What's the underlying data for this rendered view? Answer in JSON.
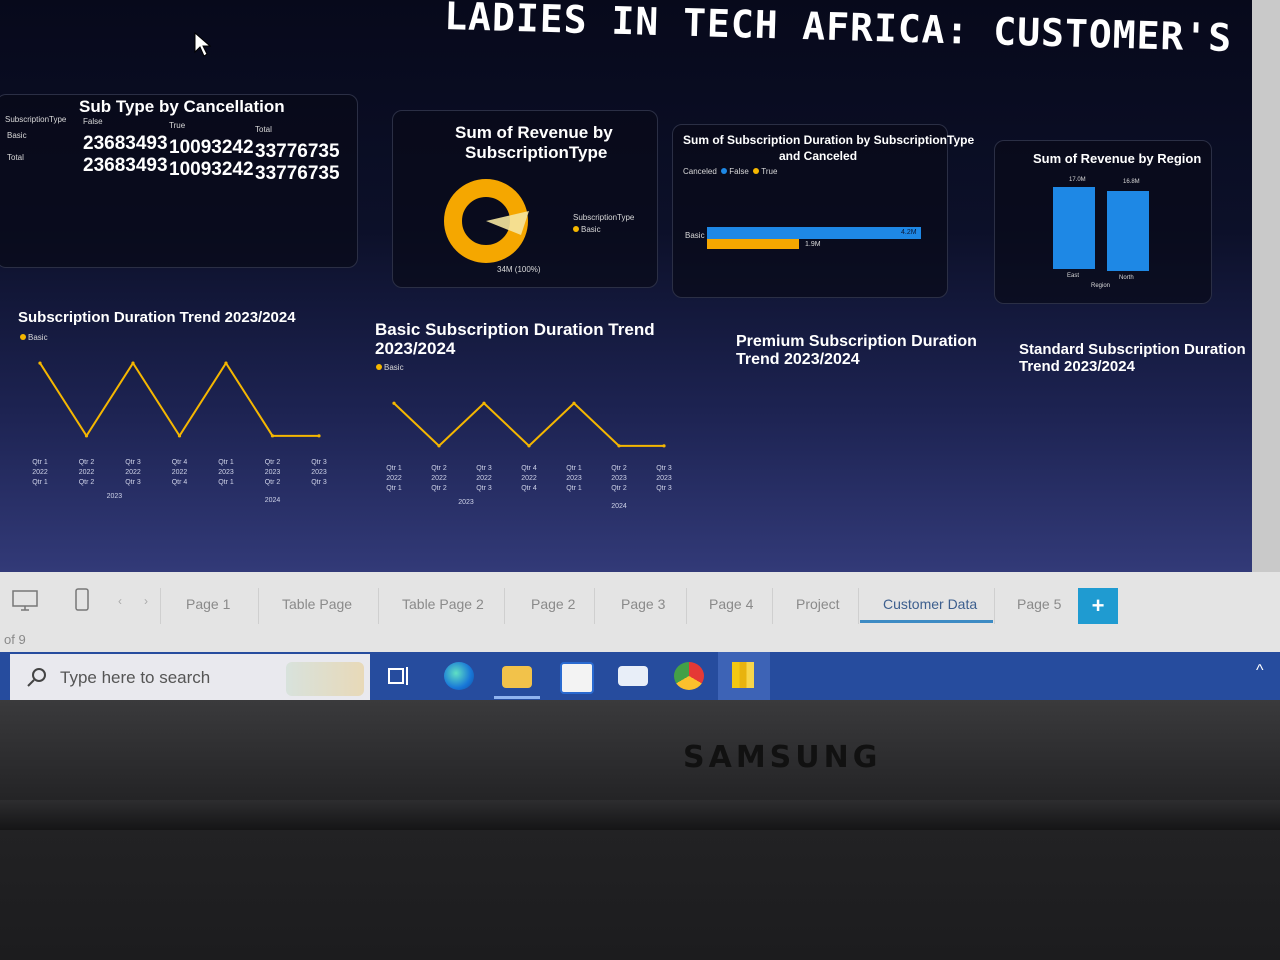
{
  "report": {
    "title": "LADIES IN TECH AFRICA: CUSTOMER'S DATA",
    "matrix": {
      "title": "Sub Type by Cancellation",
      "headers": [
        "SubscriptionType",
        "False",
        "True",
        "Total"
      ],
      "rows": [
        {
          "label": "Basic",
          "values": [
            "23683493",
            "10093242",
            "33776735"
          ]
        },
        {
          "label": "Total",
          "values": [
            "23683493",
            "10093242",
            "33776735"
          ]
        }
      ]
    },
    "donut": {
      "title_line1": "Sum of Revenue by",
      "title_line2": "SubscriptionType",
      "legend_title": "SubscriptionType",
      "legend_item": "Basic",
      "data_label": "34M (100%)",
      "color": "#f5a700"
    },
    "bar_h": {
      "title_line1": "Sum of Subscription Duration by SubscriptionType",
      "title_line2": "and Canceled",
      "legend_title": "Canceled",
      "legend_false": "False",
      "legend_true": "True",
      "category": "Basic",
      "false_label": "4.2M",
      "true_label": "1.9M",
      "color_false": "#1e88e5",
      "color_true": "#f5a700"
    },
    "region": {
      "title": "Sum of Revenue by Region",
      "label_east": "17.0M",
      "label_north": "16.8M",
      "cat_east": "East",
      "cat_north": "North",
      "axis": "Region",
      "color": "#1e88e5"
    },
    "trend1": {
      "title": "Subscription Duration Trend 2023/2024",
      "legend": "Basic"
    },
    "trend2": {
      "title_line1": "Basic Subscription Duration Trend",
      "title_line2": "2023/2024",
      "legend": "Basic"
    },
    "trend3": {
      "title_line1": "Premium Subscription Duration",
      "title_line2": "Trend 2023/2024"
    },
    "trend4": {
      "title_line1": "Standard Subscription Duration",
      "title_line2": "Trend 2023/2024"
    },
    "axis_ticks": [
      [
        "Qtr 1",
        "2022",
        "Qtr 1"
      ],
      [
        "Qtr 2",
        "2022",
        "Qtr 2"
      ],
      [
        "Qtr 3",
        "2022",
        "Qtr 3"
      ],
      [
        "Qtr 4",
        "2022",
        "Qtr 4"
      ],
      [
        "Qtr 1",
        "2023",
        "Qtr 1"
      ],
      [
        "Qtr 2",
        "2023",
        "Qtr 2"
      ],
      [
        "Qtr 3",
        "2023",
        "Qtr 3"
      ]
    ],
    "axis_years": [
      "2023",
      "2024"
    ],
    "line_color": "#f5b700"
  },
  "page_tabs": {
    "tabs": [
      "Page 1",
      "Table Page",
      "Table Page 2",
      "Page 2",
      "Page 3",
      "Page 4",
      "Project",
      "Customer Data",
      "Page 5"
    ],
    "active": "Customer Data",
    "add_label": "+",
    "page_count": "of 9"
  },
  "taskbar": {
    "search_placeholder": "Type here to search"
  },
  "bezel": {
    "brand": "SAMSUNG"
  },
  "chart_data": [
    {
      "type": "line",
      "title": "Subscription Duration Trend 2023/2024",
      "series": [
        {
          "name": "Basic",
          "values": [
            5,
            1,
            5,
            1,
            5,
            1,
            1
          ]
        }
      ],
      "categories": [
        "Qtr 1 2022",
        "Qtr 2 2022",
        "Qtr 3 2022",
        "Qtr 4 2022",
        "Qtr 1 2023",
        "Qtr 2 2023",
        "Qtr 3 2023"
      ],
      "ylim": [
        0,
        5.5
      ]
    },
    {
      "type": "line",
      "title": "Basic Subscription Duration Trend 2023/2024",
      "series": [
        {
          "name": "Basic",
          "values": [
            4,
            1,
            4,
            1,
            4,
            1,
            1
          ]
        }
      ],
      "categories": [
        "Qtr 1 2022",
        "Qtr 2 2022",
        "Qtr 3 2022",
        "Qtr 4 2022",
        "Qtr 1 2023",
        "Qtr 2 2023",
        "Qtr 3 2023"
      ],
      "ylim": [
        0,
        5.5
      ]
    },
    {
      "type": "bar",
      "title": "Sum of Revenue by Region",
      "categories": [
        "East",
        "North"
      ],
      "values": [
        17.0,
        16.8
      ],
      "ylim": [
        0,
        18
      ]
    },
    {
      "type": "bar",
      "title": "Sum of Subscription Duration by SubscriptionType and Canceled",
      "categories": [
        "Basic"
      ],
      "series": [
        {
          "name": "False",
          "values": [
            4.2
          ]
        },
        {
          "name": "True",
          "values": [
            1.9
          ]
        }
      ]
    },
    {
      "type": "pie",
      "title": "Sum of Revenue by SubscriptionType",
      "categories": [
        "Basic"
      ],
      "values": [
        34
      ]
    }
  ]
}
